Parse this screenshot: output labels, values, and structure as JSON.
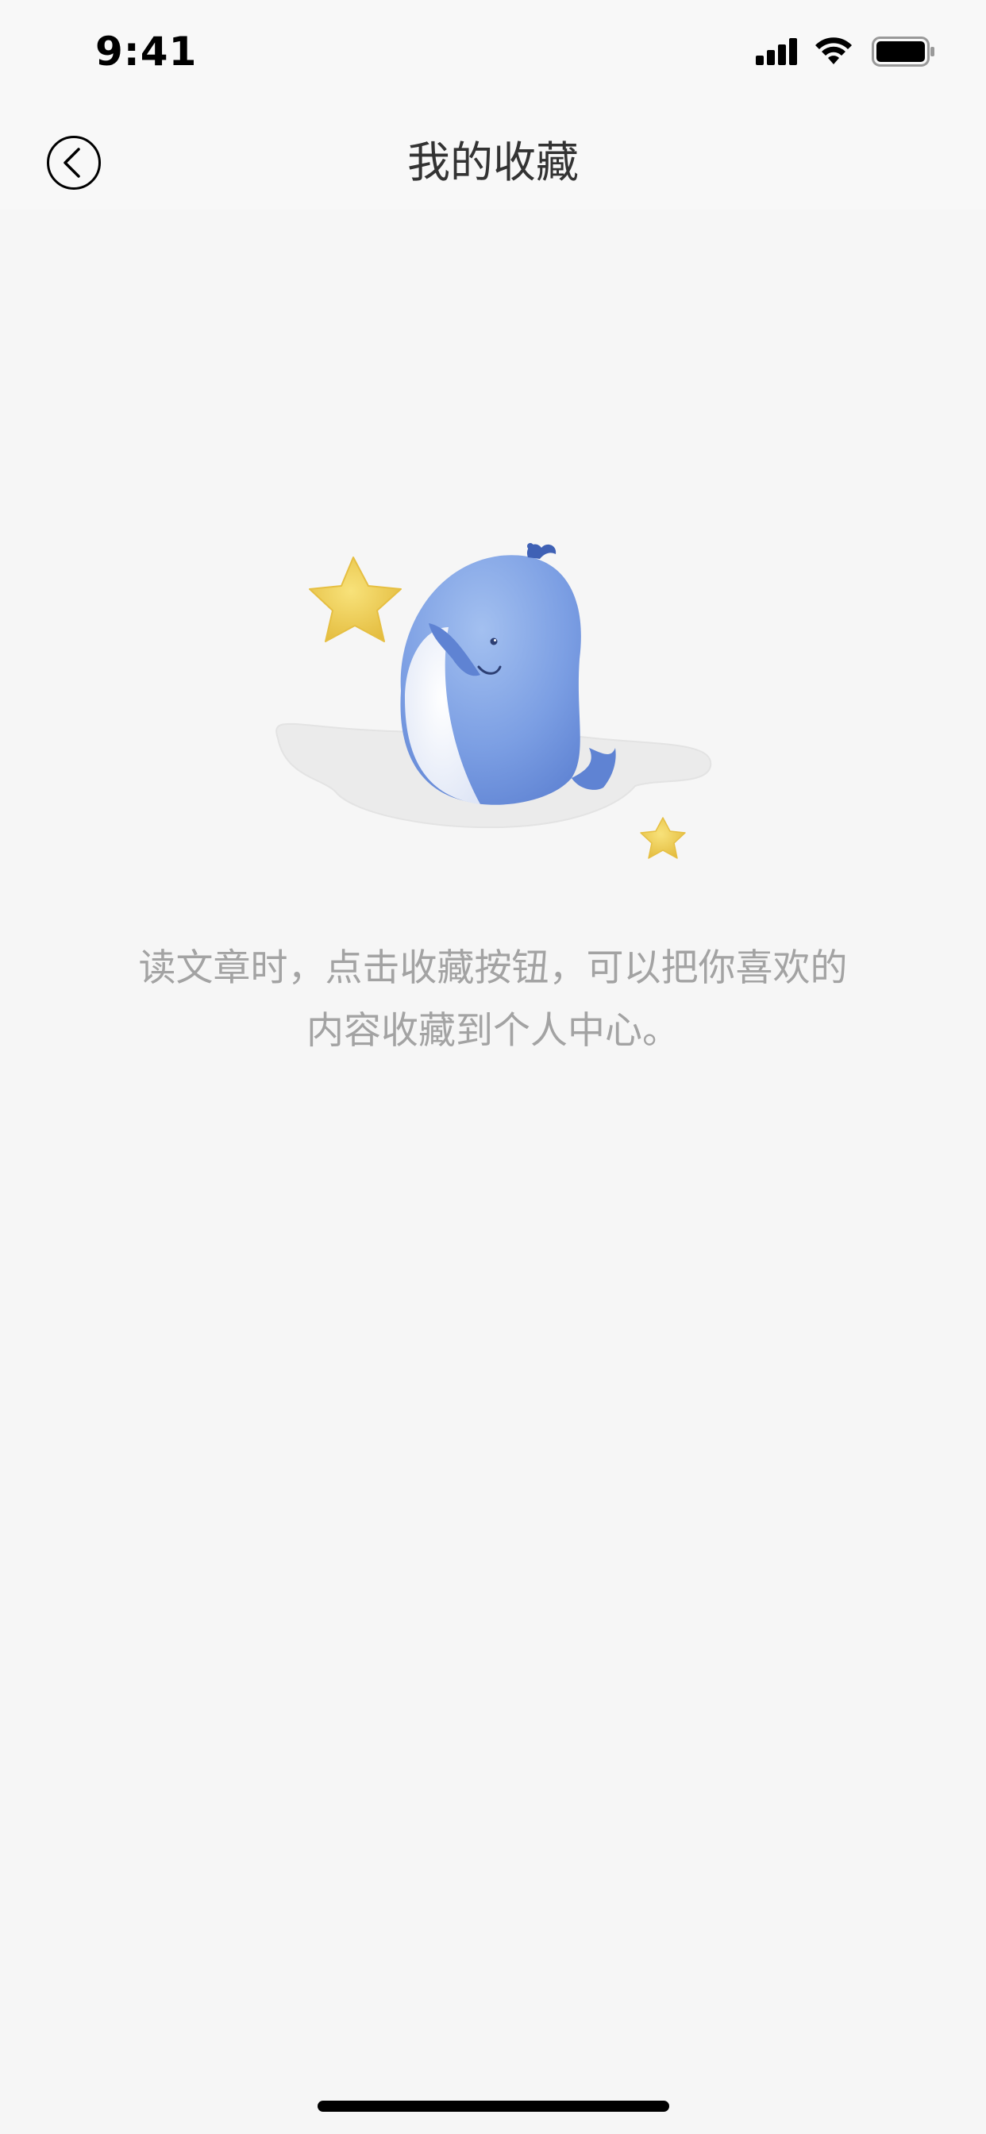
{
  "status_bar": {
    "time": "9:41",
    "icons": [
      "signal-icon",
      "wifi-icon",
      "battery-icon"
    ]
  },
  "nav": {
    "back_icon": "chevron-left-circle-icon",
    "title": "我的收藏"
  },
  "empty_state": {
    "illustration": "whale-holding-star-illustration",
    "message": "读文章时，点击收藏按钮，可以把你喜欢的内容收藏到个人中心。"
  },
  "colors": {
    "background": "#f6f6f6",
    "bar_background": "#f8f8f8",
    "title_text": "#333333",
    "message_text": "#a3a3a3",
    "whale_blue": "#6f95dd",
    "star_yellow": "#f0cf4c"
  }
}
